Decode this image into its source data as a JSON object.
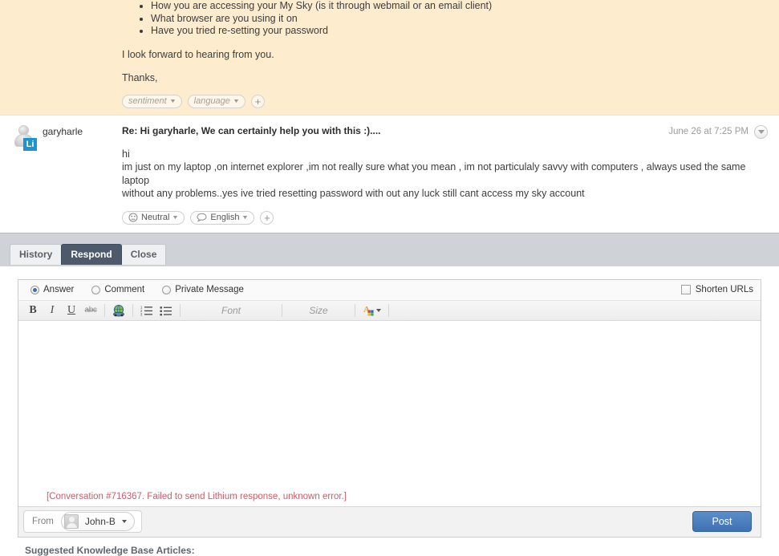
{
  "agent_message": {
    "bullets": [
      "How you are accessing your My Sky (is it through webmail or an email client)",
      "What browser are you using it on",
      "Have you tried re-setting your password"
    ],
    "closing_line": "I look forward to hearing from you.",
    "signoff": "Thanks,",
    "tags": {
      "sentiment_label": "sentiment",
      "language_label": "language",
      "add_label": "+"
    }
  },
  "user_message": {
    "username": "garyharle",
    "avatar_badge": "Li",
    "subject": "Re: Hi garyharle,   We can certainly help you with this :)....",
    "timestamp": "June 26 at 7:25 PM",
    "body_line_1": "hi",
    "body_line_2": "im just on my laptop ,on internet explorer ,im not really sure what you mean , im not particulaly savvy with computers , always used the same laptop",
    "body_line_3": "without any problems..yes ive tried resetting password with out any luck still cant access my sky account",
    "tags": {
      "sentiment_label": "Neutral",
      "language_label": "English",
      "add_label": "+"
    }
  },
  "tabs": [
    {
      "label": "History",
      "active": false
    },
    {
      "label": "Respond",
      "active": true
    },
    {
      "label": "Close",
      "active": false
    }
  ],
  "composer": {
    "reply_types": [
      {
        "label": "Answer",
        "selected": true
      },
      {
        "label": "Comment",
        "selected": false
      },
      {
        "label": "Private Message",
        "selected": false
      }
    ],
    "shorten_urls": {
      "label": "Shorten URLs",
      "checked": false
    },
    "toolbar": {
      "bold": "B",
      "italic": "I",
      "underline": "U",
      "strikethrough": "abc",
      "font_placeholder": "Font",
      "size_placeholder": "Size"
    },
    "editor_value": "",
    "error_text": "[Conversation #716367. Failed to send Lithium response, unknown error.]",
    "from_label": "From",
    "from_value": "John-B",
    "post_label": "Post"
  },
  "kb_section": {
    "title": "Suggested Knowledge Base Articles:"
  },
  "colors": {
    "agent_bg": "#fdeccd",
    "tabstrip_bg": "#cfd2d6",
    "tab_active_bg": "#4c5a6b",
    "post_btn": "#4a7ebd",
    "error_text": "#d05a6a",
    "li_badge": "#1e93d2"
  }
}
